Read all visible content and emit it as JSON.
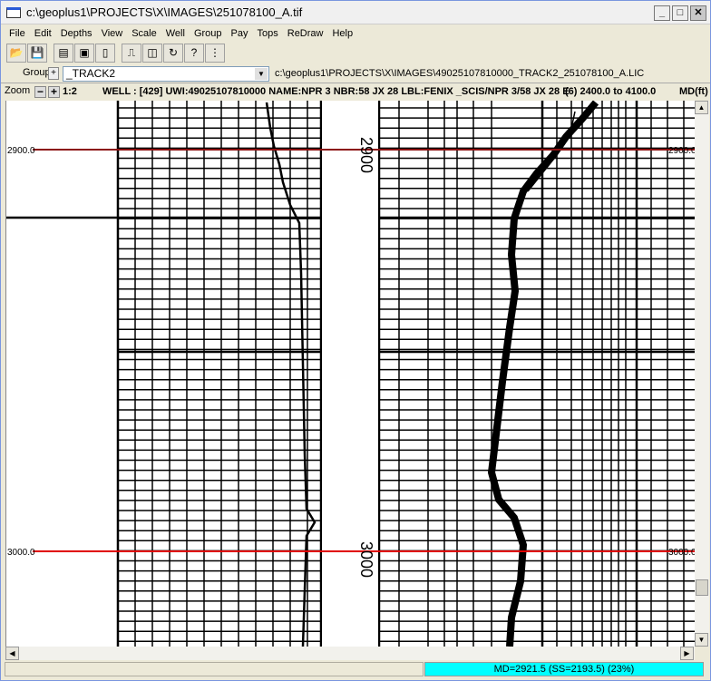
{
  "window": {
    "title": "c:\\geoplus1\\PROJECTS\\X\\IMAGES\\251078100_A.tif",
    "minimize": "_",
    "maximize": "□",
    "close": "✕"
  },
  "menu": [
    "File",
    "Edit",
    "Depths",
    "View",
    "Scale",
    "Well",
    "Group",
    "Pay",
    "Tops",
    "ReDraw",
    "Help"
  ],
  "toolbar": [
    {
      "icon": "open-folder-icon",
      "glyph": "📂"
    },
    {
      "icon": "save-icon",
      "glyph": "💾"
    },
    {
      "icon": "track-layout-icon",
      "glyph": "▤"
    },
    {
      "icon": "track-border-icon",
      "glyph": "▣"
    },
    {
      "icon": "track-columns-icon",
      "glyph": "▯"
    },
    {
      "icon": "curve-icon",
      "glyph": "⎍"
    },
    {
      "icon": "track-split-icon",
      "glyph": "◫"
    },
    {
      "icon": "refresh-icon",
      "glyph": "↻"
    },
    {
      "icon": "help-query-icon",
      "glyph": "?"
    },
    {
      "icon": "scale-bar-icon",
      "glyph": "⋮"
    }
  ],
  "group": {
    "label": "Group",
    "plus": "+",
    "selected": "_TRACK2",
    "file_path": "c:\\geoplus1\\PROJECTS\\X\\IMAGES\\49025107810000_TRACK2_251078100_A.LIC"
  },
  "zoom": {
    "label": "Zoom",
    "minus": "−",
    "plus": "+",
    "ratio": "1:2"
  },
  "well_info": "WELL : [429] UWI:49025107810000 NAME:NPR 3 NBR:58 JX 28 LBL:FENIX _SCIS/NPR 3/58 JX 28 E",
  "depth_range": "(6) 2400.0 to 4100.0",
  "depth_unit": "MD(ft)",
  "depth_markers": [
    {
      "label": "2900.0",
      "color": "#8b1010"
    },
    {
      "label": "3000.0",
      "color": "#e00000"
    }
  ],
  "log_depth_labels": [
    "2900",
    "3000"
  ],
  "status": {
    "left": "",
    "position": "MD=2921.5 (SS=2193.5) (23%)",
    "color": "#00ffff"
  }
}
